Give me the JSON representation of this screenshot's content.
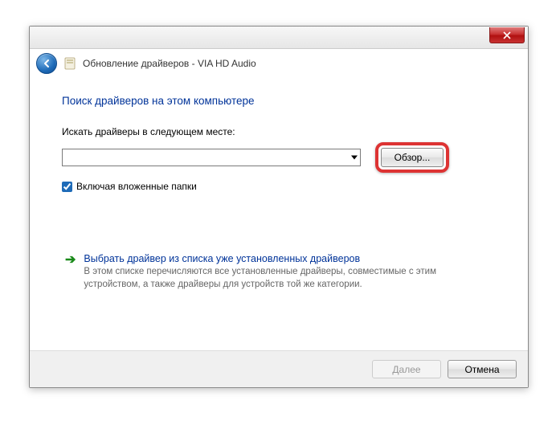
{
  "window": {
    "title": "Обновление драйверов - VIA HD Audio"
  },
  "heading": "Поиск драйверов на этом компьютере",
  "path": {
    "label": "Искать драйверы в следующем месте:",
    "value": "",
    "browse_label": "Обзор..."
  },
  "subfolders": {
    "label": "Включая вложенные папки",
    "checked": true
  },
  "option": {
    "title": "Выбрать драйвер из списка уже установленных драйверов",
    "desc": "В этом списке перечисляются все установленные драйверы, совместимые с этим устройством, а также драйверы для устройств той же категории."
  },
  "footer": {
    "next": "Далее",
    "cancel": "Отмена"
  }
}
